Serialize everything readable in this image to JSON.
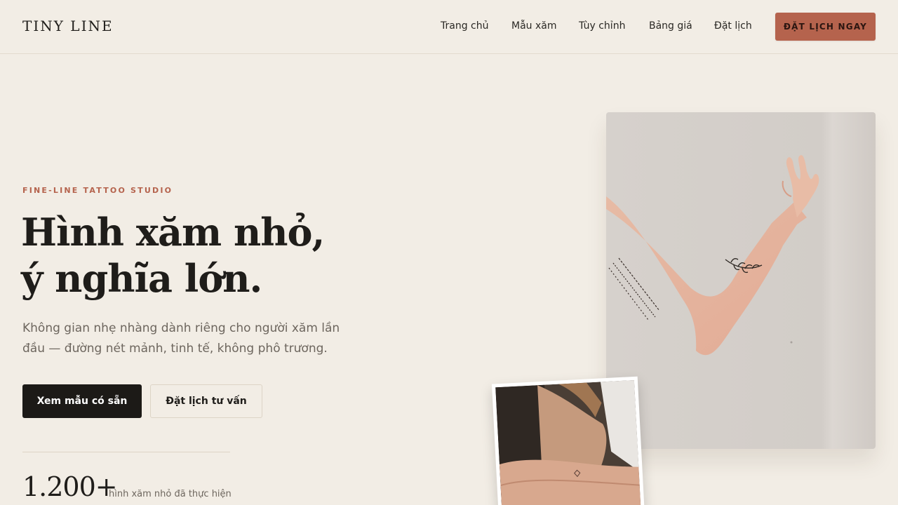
{
  "brand": {
    "name": "TINY LINE"
  },
  "nav": {
    "links": [
      "Trang chủ",
      "Mẫu xăm",
      "Tùy chỉnh",
      "Bảng giá",
      "Đặt lịch"
    ],
    "cta": "ĐẶT LỊCH NGAY"
  },
  "hero": {
    "eyebrow": "FINE-LINE TATTOO STUDIO",
    "headline_line1": "Hình xăm nhỏ,",
    "headline_line2": "ý nghĩa lớn.",
    "lead": "Không gian nhẹ nhàng dành riêng cho người xăm lần đầu — đường nét mảnh, tinh tế, không phô trương.",
    "primary_button": "Xem mẫu có sẵn",
    "secondary_button": "Đặt lịch tư vấn",
    "stat_value": "1.200+",
    "stat_label": "hình xăm nhỏ đã thực hiện"
  },
  "colors": {
    "background": "#f2ede5",
    "accent": "#b5634d",
    "ink": "#1c1a17",
    "muted": "#6d665e"
  }
}
